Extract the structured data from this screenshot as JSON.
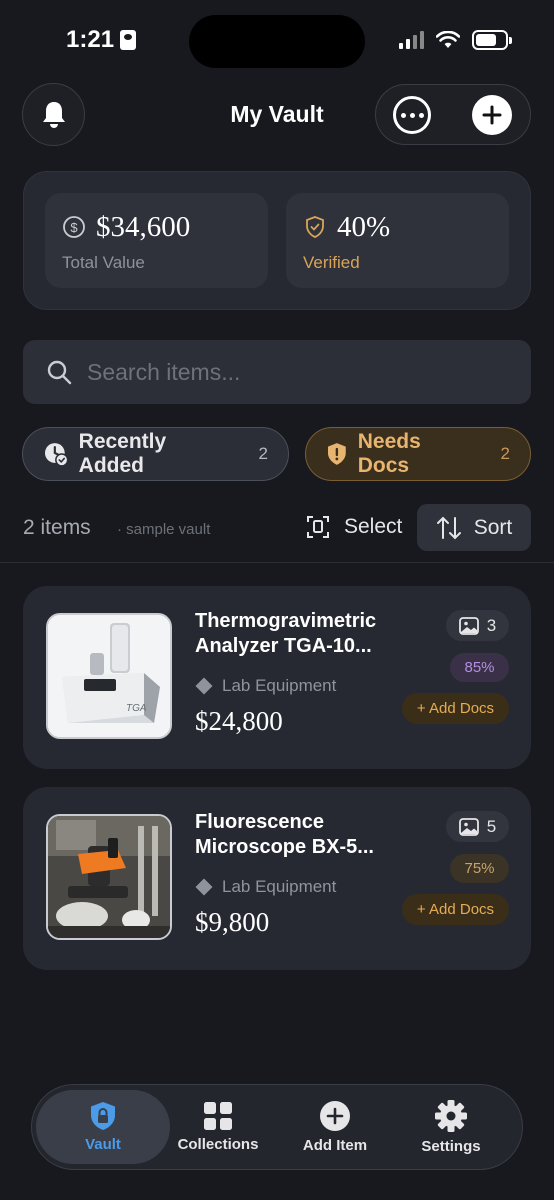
{
  "status_bar": {
    "time": "1:21"
  },
  "header": {
    "title": "My Vault"
  },
  "stats": {
    "total_value": "$34,600",
    "total_value_label": "Total Value",
    "verified_value": "40%",
    "verified_label": "Verified"
  },
  "search": {
    "placeholder": "Search items..."
  },
  "filters": [
    {
      "label": "Recently Added",
      "count": "2"
    },
    {
      "label": "Needs Docs",
      "count": "2"
    }
  ],
  "list_header": {
    "count_label": "2 items",
    "note": "· sample vault",
    "select_label": "Select",
    "sort_label": "Sort"
  },
  "items": [
    {
      "name_line1": "Thermogravimetric",
      "name_line2": "Analyzer TGA-10...",
      "category": "Lab Equipment",
      "price": "$24,800",
      "image_count": "3",
      "verified_pct": "85%",
      "docs_label": "+ Add Docs"
    },
    {
      "name_line1": "Fluorescence",
      "name_line2": "Microscope BX-5...",
      "category": "Lab Equipment",
      "price": "$9,800",
      "image_count": "5",
      "verified_pct": "75%",
      "docs_label": "+ Add Docs"
    }
  ],
  "tabs": [
    {
      "label": "Vault",
      "icon": "shield-lock-icon",
      "active": true
    },
    {
      "label": "Collections",
      "icon": "grid-icon"
    },
    {
      "label": "Add Item",
      "icon": "plus-circle-icon"
    },
    {
      "label": "Settings",
      "icon": "gear-icon"
    }
  ],
  "colors": {
    "background": "#17191e",
    "card": "#262932",
    "accent_blue": "#4b9be8",
    "docs_amber": "#e4ac55",
    "pct_purple": "#b48ee0",
    "pct_amber": "#c9a36a"
  }
}
